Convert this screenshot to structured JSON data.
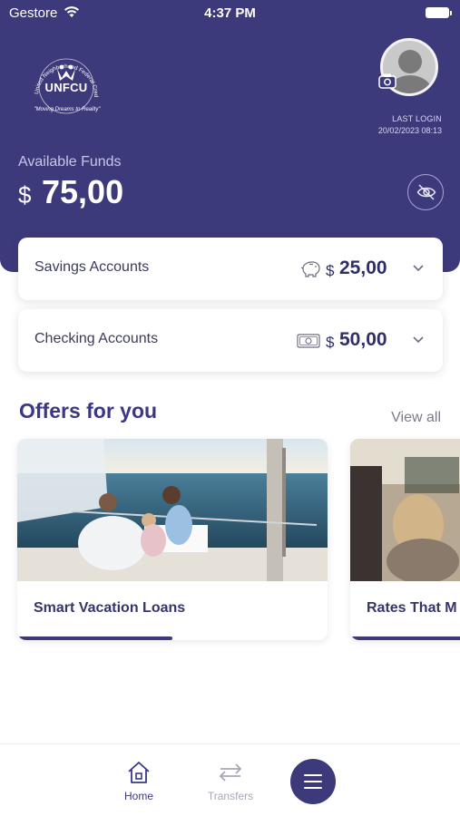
{
  "status_bar": {
    "carrier": "Gestore",
    "time": "4:37 PM"
  },
  "header": {
    "logo_text": "UNFCU",
    "logo_ring_text": "United Neighborhood Federal Credit Union",
    "logo_tagline": "\"Moving Dreams to Reality\"",
    "last_login_label": "LAST LOGIN",
    "last_login_value": "20/02/2023 08:13",
    "funds_label": "Available Funds",
    "funds_currency": "$",
    "funds_value": "75,00"
  },
  "accounts": [
    {
      "name": "Savings Accounts",
      "icon": "piggy-bank-icon",
      "currency": "$",
      "amount": "25,00"
    },
    {
      "name": "Checking Accounts",
      "icon": "banknote-icon",
      "currency": "$",
      "amount": "50,00"
    }
  ],
  "offers": {
    "title": "Offers for you",
    "view_all": "View all",
    "items": [
      {
        "title": "Smart Vacation Loans",
        "progress": 0.5
      },
      {
        "title": "Rates That M",
        "progress": 1.0
      }
    ]
  },
  "bottom_nav": {
    "items": [
      {
        "label": "Home",
        "icon": "home-icon",
        "active": true
      },
      {
        "label": "Transfers",
        "icon": "transfers-icon",
        "active": false
      }
    ],
    "menu_icon": "hamburger-menu-icon"
  },
  "colors": {
    "brand": "#3d3a7c",
    "brand_text": "#3a3787",
    "background": "#ffffff"
  }
}
